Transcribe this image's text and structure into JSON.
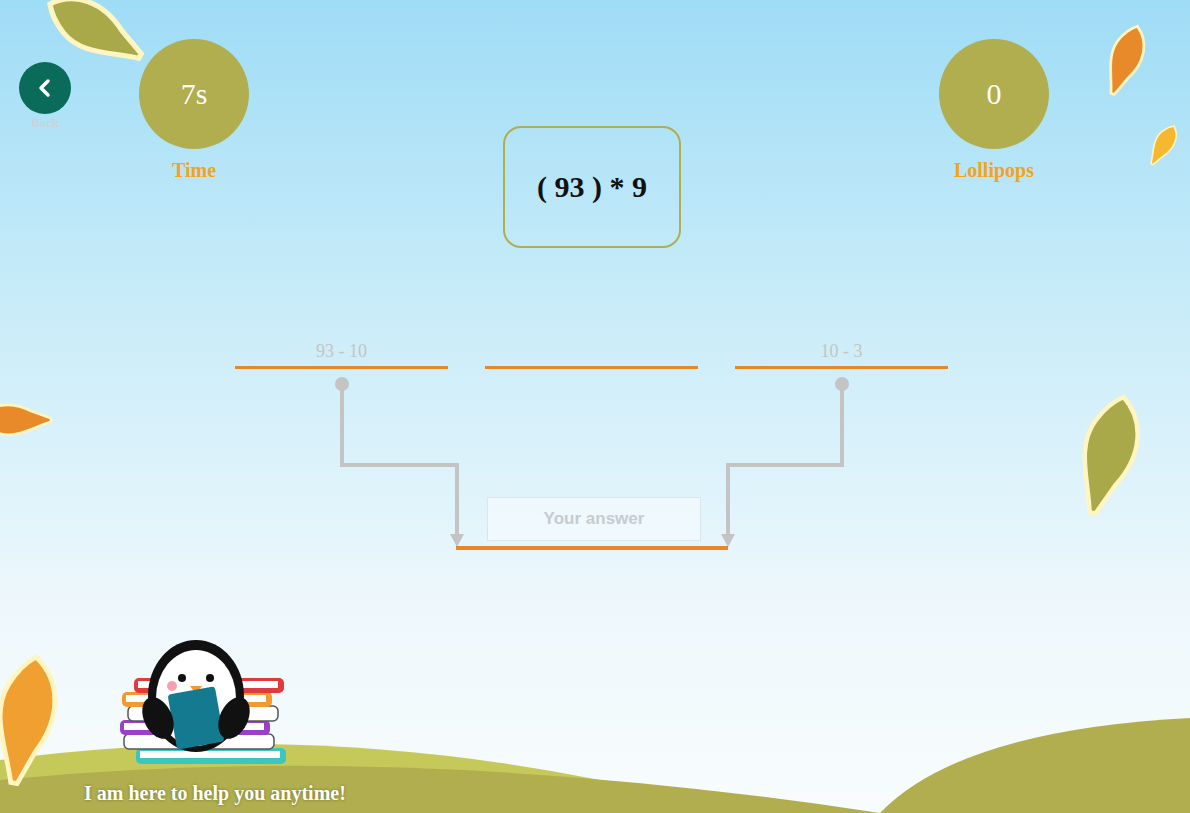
{
  "back": {
    "label": "Back"
  },
  "time": {
    "value": "7s",
    "label": "Time"
  },
  "score": {
    "value": "0",
    "label": "Lollipops"
  },
  "question": "( 93 ) * 9",
  "slots": [
    {
      "text": "93 - 10",
      "connected": true
    },
    {
      "text": "",
      "connected": false
    },
    {
      "text": "10 - 3",
      "connected": true
    }
  ],
  "answer": {
    "placeholder": "Your answer"
  },
  "helper": {
    "message": "I am here to help you anytime!"
  }
}
